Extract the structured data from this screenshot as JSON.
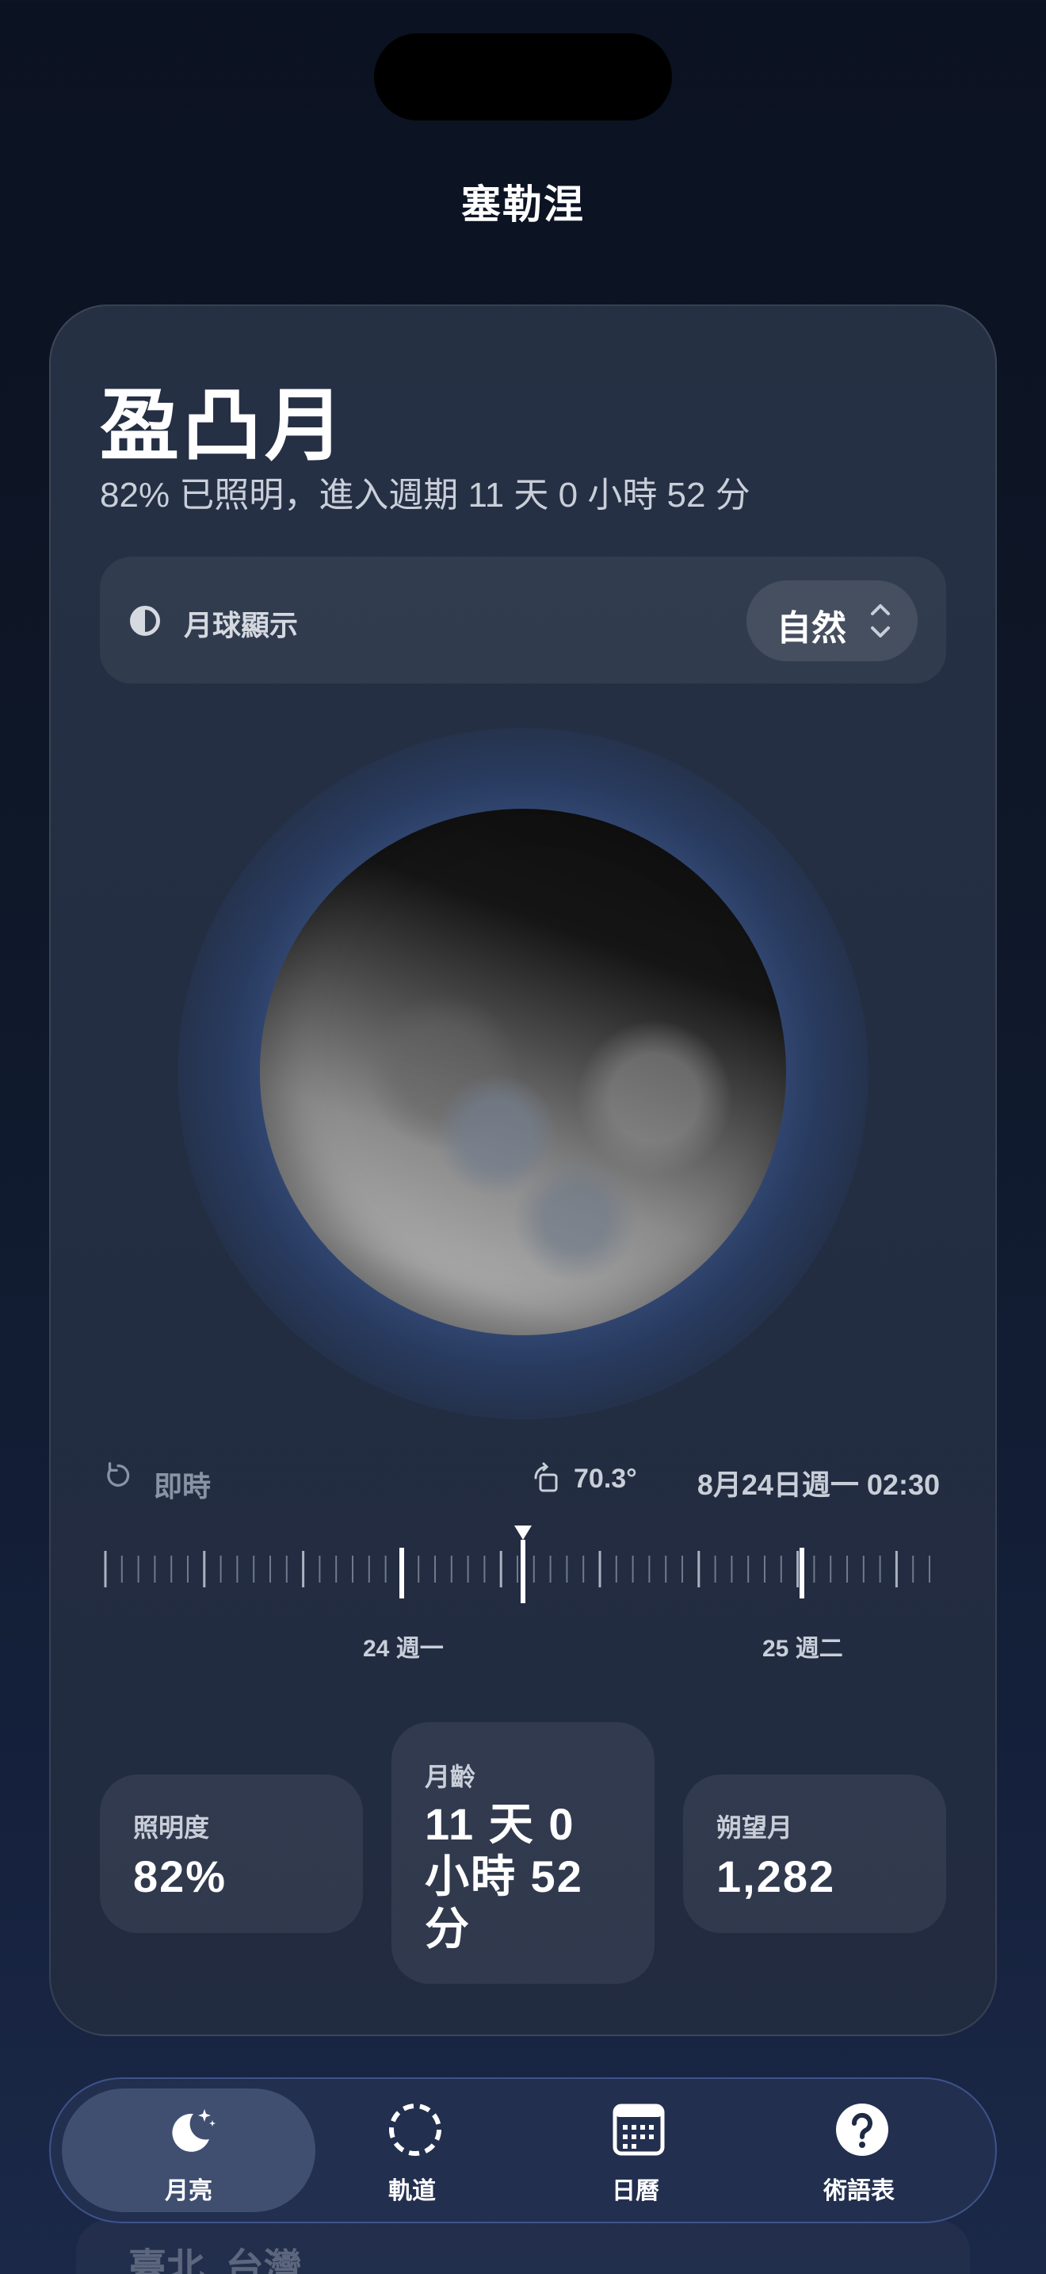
{
  "header": {
    "location": "塞勒涅"
  },
  "phase": {
    "name": "盈凸月",
    "subtitle": "82% 已照明，進入週期 11 天 0 小時 52 分"
  },
  "display_mode": {
    "label": "月球顯示",
    "value": "自然",
    "icon": "half-circle-icon"
  },
  "time_controls": {
    "live_label": "即時",
    "angle": "70.3°",
    "datetime": "8月24日週一 02:30"
  },
  "timeline": {
    "day_labels": [
      "24 週一",
      "25 週二"
    ]
  },
  "stats": [
    {
      "label": "照明度",
      "value": "82%"
    },
    {
      "label": "月齡",
      "value": "11 天 0 小時 52 分"
    },
    {
      "label": "朔望月",
      "value": "1,282"
    }
  ],
  "tabbar": {
    "tabs": [
      {
        "label": "月亮",
        "icon": "moon-stars-icon",
        "active": true
      },
      {
        "label": "軌道",
        "icon": "dashed-circle-icon",
        "active": false
      },
      {
        "label": "日曆",
        "icon": "calendar-icon",
        "active": false
      },
      {
        "label": "術語表",
        "icon": "question-icon",
        "active": false
      }
    ]
  },
  "behind_card": {
    "text": "臺北, 台灣"
  },
  "colors": {
    "background": "#0f1829",
    "card": "#262f42",
    "accent_glow": "#41609b",
    "text_secondary": "#c9cfd9"
  }
}
